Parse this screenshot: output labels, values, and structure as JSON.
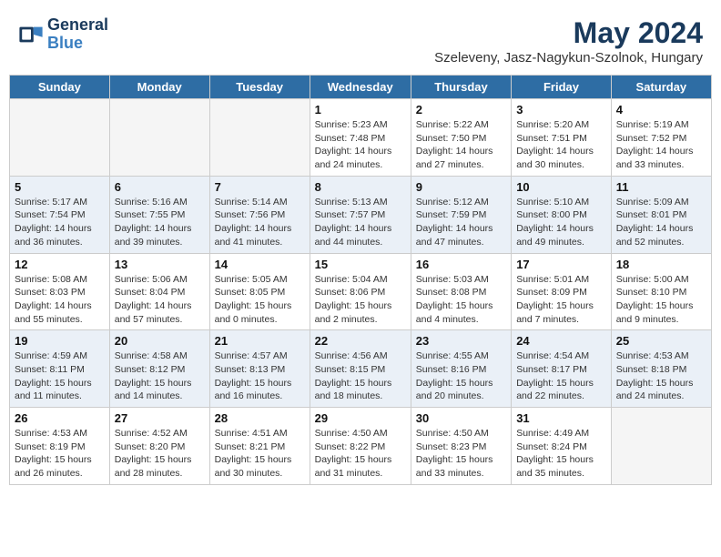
{
  "header": {
    "logo_general": "General",
    "logo_blue": "Blue",
    "main_title": "May 2024",
    "subtitle": "Szeleveny, Jasz-Nagykun-Szolnok, Hungary"
  },
  "weekdays": [
    "Sunday",
    "Monday",
    "Tuesday",
    "Wednesday",
    "Thursday",
    "Friday",
    "Saturday"
  ],
  "weeks": [
    [
      {
        "day": "",
        "info": ""
      },
      {
        "day": "",
        "info": ""
      },
      {
        "day": "",
        "info": ""
      },
      {
        "day": "1",
        "info": "Sunrise: 5:23 AM\nSunset: 7:48 PM\nDaylight: 14 hours\nand 24 minutes."
      },
      {
        "day": "2",
        "info": "Sunrise: 5:22 AM\nSunset: 7:50 PM\nDaylight: 14 hours\nand 27 minutes."
      },
      {
        "day": "3",
        "info": "Sunrise: 5:20 AM\nSunset: 7:51 PM\nDaylight: 14 hours\nand 30 minutes."
      },
      {
        "day": "4",
        "info": "Sunrise: 5:19 AM\nSunset: 7:52 PM\nDaylight: 14 hours\nand 33 minutes."
      }
    ],
    [
      {
        "day": "5",
        "info": "Sunrise: 5:17 AM\nSunset: 7:54 PM\nDaylight: 14 hours\nand 36 minutes."
      },
      {
        "day": "6",
        "info": "Sunrise: 5:16 AM\nSunset: 7:55 PM\nDaylight: 14 hours\nand 39 minutes."
      },
      {
        "day": "7",
        "info": "Sunrise: 5:14 AM\nSunset: 7:56 PM\nDaylight: 14 hours\nand 41 minutes."
      },
      {
        "day": "8",
        "info": "Sunrise: 5:13 AM\nSunset: 7:57 PM\nDaylight: 14 hours\nand 44 minutes."
      },
      {
        "day": "9",
        "info": "Sunrise: 5:12 AM\nSunset: 7:59 PM\nDaylight: 14 hours\nand 47 minutes."
      },
      {
        "day": "10",
        "info": "Sunrise: 5:10 AM\nSunset: 8:00 PM\nDaylight: 14 hours\nand 49 minutes."
      },
      {
        "day": "11",
        "info": "Sunrise: 5:09 AM\nSunset: 8:01 PM\nDaylight: 14 hours\nand 52 minutes."
      }
    ],
    [
      {
        "day": "12",
        "info": "Sunrise: 5:08 AM\nSunset: 8:03 PM\nDaylight: 14 hours\nand 55 minutes."
      },
      {
        "day": "13",
        "info": "Sunrise: 5:06 AM\nSunset: 8:04 PM\nDaylight: 14 hours\nand 57 minutes."
      },
      {
        "day": "14",
        "info": "Sunrise: 5:05 AM\nSunset: 8:05 PM\nDaylight: 15 hours\nand 0 minutes."
      },
      {
        "day": "15",
        "info": "Sunrise: 5:04 AM\nSunset: 8:06 PM\nDaylight: 15 hours\nand 2 minutes."
      },
      {
        "day": "16",
        "info": "Sunrise: 5:03 AM\nSunset: 8:08 PM\nDaylight: 15 hours\nand 4 minutes."
      },
      {
        "day": "17",
        "info": "Sunrise: 5:01 AM\nSunset: 8:09 PM\nDaylight: 15 hours\nand 7 minutes."
      },
      {
        "day": "18",
        "info": "Sunrise: 5:00 AM\nSunset: 8:10 PM\nDaylight: 15 hours\nand 9 minutes."
      }
    ],
    [
      {
        "day": "19",
        "info": "Sunrise: 4:59 AM\nSunset: 8:11 PM\nDaylight: 15 hours\nand 11 minutes."
      },
      {
        "day": "20",
        "info": "Sunrise: 4:58 AM\nSunset: 8:12 PM\nDaylight: 15 hours\nand 14 minutes."
      },
      {
        "day": "21",
        "info": "Sunrise: 4:57 AM\nSunset: 8:13 PM\nDaylight: 15 hours\nand 16 minutes."
      },
      {
        "day": "22",
        "info": "Sunrise: 4:56 AM\nSunset: 8:15 PM\nDaylight: 15 hours\nand 18 minutes."
      },
      {
        "day": "23",
        "info": "Sunrise: 4:55 AM\nSunset: 8:16 PM\nDaylight: 15 hours\nand 20 minutes."
      },
      {
        "day": "24",
        "info": "Sunrise: 4:54 AM\nSunset: 8:17 PM\nDaylight: 15 hours\nand 22 minutes."
      },
      {
        "day": "25",
        "info": "Sunrise: 4:53 AM\nSunset: 8:18 PM\nDaylight: 15 hours\nand 24 minutes."
      }
    ],
    [
      {
        "day": "26",
        "info": "Sunrise: 4:53 AM\nSunset: 8:19 PM\nDaylight: 15 hours\nand 26 minutes."
      },
      {
        "day": "27",
        "info": "Sunrise: 4:52 AM\nSunset: 8:20 PM\nDaylight: 15 hours\nand 28 minutes."
      },
      {
        "day": "28",
        "info": "Sunrise: 4:51 AM\nSunset: 8:21 PM\nDaylight: 15 hours\nand 30 minutes."
      },
      {
        "day": "29",
        "info": "Sunrise: 4:50 AM\nSunset: 8:22 PM\nDaylight: 15 hours\nand 31 minutes."
      },
      {
        "day": "30",
        "info": "Sunrise: 4:50 AM\nSunset: 8:23 PM\nDaylight: 15 hours\nand 33 minutes."
      },
      {
        "day": "31",
        "info": "Sunrise: 4:49 AM\nSunset: 8:24 PM\nDaylight: 15 hours\nand 35 minutes."
      },
      {
        "day": "",
        "info": ""
      }
    ]
  ]
}
